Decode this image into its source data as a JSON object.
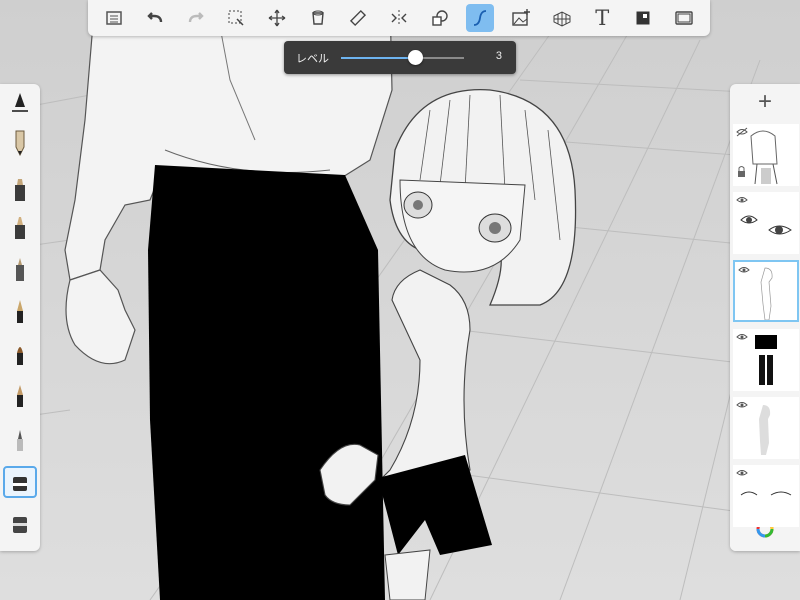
{
  "toolbar": {
    "items": [
      {
        "name": "layer-list-icon",
        "active": false
      },
      {
        "name": "undo-icon",
        "active": false
      },
      {
        "name": "redo-icon",
        "active": false
      },
      {
        "name": "selection-icon",
        "active": false
      },
      {
        "name": "transform-icon",
        "active": false
      },
      {
        "name": "fill-bucket-icon",
        "active": false
      },
      {
        "name": "ruler-icon",
        "active": false
      },
      {
        "name": "symmetry-icon",
        "active": false
      },
      {
        "name": "shapes-icon",
        "active": false
      },
      {
        "name": "curves-icon",
        "active": true
      },
      {
        "name": "image-import-icon",
        "active": false
      },
      {
        "name": "perspective-grid-icon",
        "active": false
      },
      {
        "name": "text-icon",
        "active": false,
        "glyph": "T"
      },
      {
        "name": "copic-color-icon",
        "active": false
      },
      {
        "name": "fullscreen-icon",
        "active": false
      }
    ],
    "active_color": "#7fbdf0"
  },
  "level_popup": {
    "label": "レベル",
    "value": "3",
    "fraction": 0.6
  },
  "brushes": {
    "items": [
      {
        "name": "brush-settings-icon"
      },
      {
        "name": "pencil-brush-icon"
      },
      {
        "name": "marker-brush-icon"
      },
      {
        "name": "chisel-marker-brush-icon"
      },
      {
        "name": "airbrush-brush-icon"
      },
      {
        "name": "fountain-pen-brush-icon"
      },
      {
        "name": "paint-brush-icon"
      },
      {
        "name": "ink-pen-brush-icon"
      },
      {
        "name": "fine-tip-brush-icon"
      },
      {
        "name": "eraser-brush-icon",
        "selected": true
      },
      {
        "name": "soft-eraser-brush-icon"
      }
    ]
  },
  "layers": {
    "add_label": "+",
    "items": [
      {
        "name": "layer-man-sketch",
        "visible": false,
        "locked": true,
        "selected": false
      },
      {
        "name": "layer-eyes",
        "visible": true,
        "locked": false,
        "selected": false
      },
      {
        "name": "layer-girl-lineart",
        "visible": true,
        "locked": false,
        "selected": true
      },
      {
        "name": "layer-black-fill",
        "visible": true,
        "locked": false,
        "selected": false
      },
      {
        "name": "layer-gray-base",
        "visible": true,
        "locked": false,
        "selected": false
      },
      {
        "name": "layer-eye-sketch",
        "visible": true,
        "locked": false,
        "selected": false
      }
    ],
    "selected_color": "#7fc6f2"
  },
  "color_button": {
    "name": "color-wheel-icon"
  }
}
